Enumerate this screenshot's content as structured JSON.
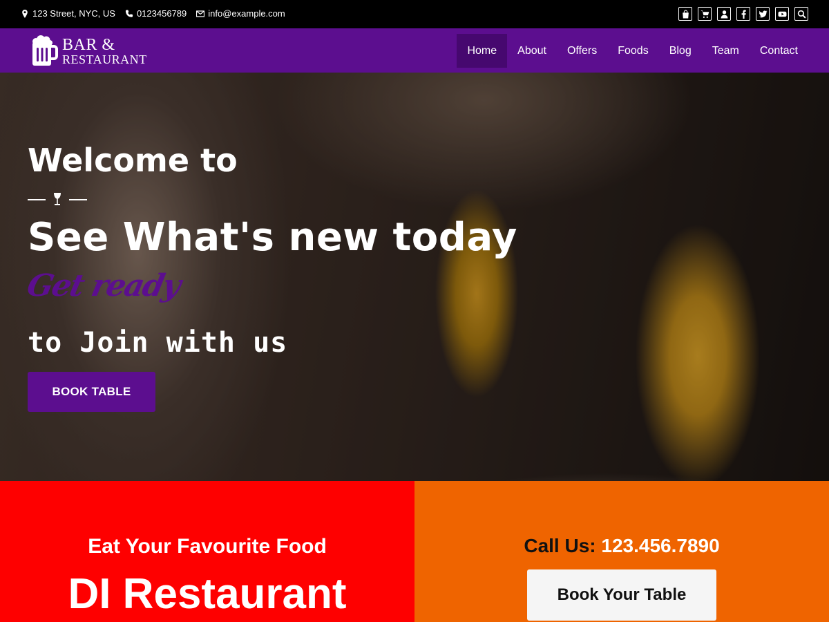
{
  "topbar": {
    "address": "123 Street, NYC, US",
    "phone": "0123456789",
    "email": "info@example.com",
    "icons": [
      "shopping-bag-icon",
      "cart-icon",
      "user-icon",
      "facebook-icon",
      "twitter-icon",
      "youtube-icon",
      "search-icon"
    ]
  },
  "brand": {
    "line1": "BAR &",
    "line2": "RESTAURANT"
  },
  "nav": {
    "items": [
      {
        "label": "Home"
      },
      {
        "label": "About"
      },
      {
        "label": "Offers"
      },
      {
        "label": "Foods"
      },
      {
        "label": "Blog"
      },
      {
        "label": "Team"
      },
      {
        "label": "Contact"
      }
    ],
    "active": "Home"
  },
  "hero": {
    "welcome": "Welcome to",
    "headline": "See What's new today",
    "script": "Get ready",
    "join": "to Join with us",
    "button": "BOOK TABLE"
  },
  "promo": {
    "subtitle": "Eat Your Favourite Food",
    "title": "DI Restaurant",
    "call_label": "Call Us:",
    "call_number": "123.456.7890",
    "button": "Book Your Table"
  },
  "colors": {
    "brand_purple": "#5c0e8f",
    "red_panel": "#fe0000",
    "orange_panel": "#ef6400"
  }
}
